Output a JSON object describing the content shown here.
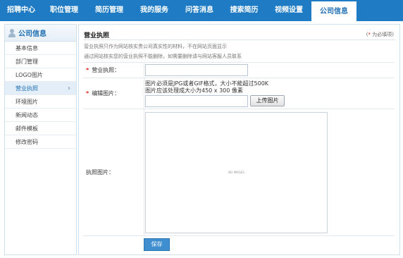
{
  "nav": {
    "items": [
      {
        "label": "招聘中心"
      },
      {
        "label": "职位管理"
      },
      {
        "label": "简历管理"
      },
      {
        "label": "我的服务"
      },
      {
        "label": "问答消息"
      },
      {
        "label": "搜索简历"
      },
      {
        "label": "视频设置"
      },
      {
        "label": "公司信息"
      }
    ],
    "active_index": 7
  },
  "sidebar": {
    "title": "公司信息",
    "items": [
      {
        "label": "基本信息"
      },
      {
        "label": "部门管理"
      },
      {
        "label": "LOGO图片"
      },
      {
        "label": "营业执照"
      },
      {
        "label": "环境图片"
      },
      {
        "label": "新闻动态"
      },
      {
        "label": "邮件模板"
      },
      {
        "label": "修改密码"
      }
    ],
    "active_index": 3
  },
  "main": {
    "title": "营业执照",
    "required_note": "为必填项",
    "required_note_star": "*",
    "desc1": "营业执照只作为网站核实贵公司真实性的材料，不在网站页面显示",
    "desc2": "通过网站核实您的营业执照不能删除，如需要删除请与网站客服人员联系"
  },
  "form": {
    "star": "*",
    "license_label": "营业执照：",
    "license_value": "",
    "edit_label": "编辑图片：",
    "hint1": "图片必须是JPG或者GIF格式，大小不能超过500K",
    "hint2": "图片应该处理成大小为450 x 300 像素",
    "file_value": "",
    "upload_label": "上传图片",
    "preview_label": "执照图片：",
    "preview_placeholder": "NO IMAGES"
  },
  "save_label": "保存",
  "colors": {
    "nav_bg": "#1f7cc4",
    "accent": "#1f6fb2",
    "required": "#dd2222",
    "save_button": "#3f8ed0"
  }
}
